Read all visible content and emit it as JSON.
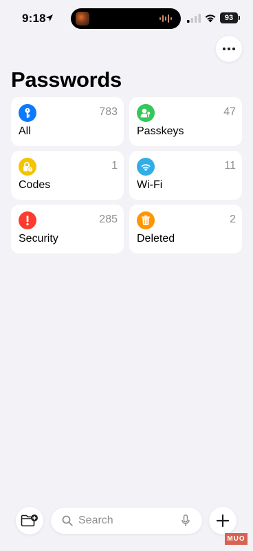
{
  "status_bar": {
    "time": "9:18",
    "battery": "93"
  },
  "header": {
    "title": "Passwords",
    "more_icon": "ellipsis-icon"
  },
  "categories": [
    {
      "label": "All",
      "count": "783",
      "icon": "key-icon",
      "color": "#0a7aff"
    },
    {
      "label": "Passkeys",
      "count": "47",
      "icon": "person-key-icon",
      "color": "#34c759"
    },
    {
      "label": "Codes",
      "count": "1",
      "icon": "lock-clock-icon",
      "color": "#f5c400"
    },
    {
      "label": "Wi-Fi",
      "count": "11",
      "icon": "wifi-icon",
      "color": "#32ade6"
    },
    {
      "label": "Security",
      "count": "285",
      "icon": "exclamation-icon",
      "color": "#ff3b30"
    },
    {
      "label": "Deleted",
      "count": "2",
      "icon": "trash-icon",
      "color": "#ff9500"
    }
  ],
  "bottom_bar": {
    "search_placeholder": "Search",
    "folder_icon": "new-folder-icon",
    "add_icon": "plus-icon",
    "mic_icon": "microphone-icon"
  },
  "watermark": "MUO"
}
